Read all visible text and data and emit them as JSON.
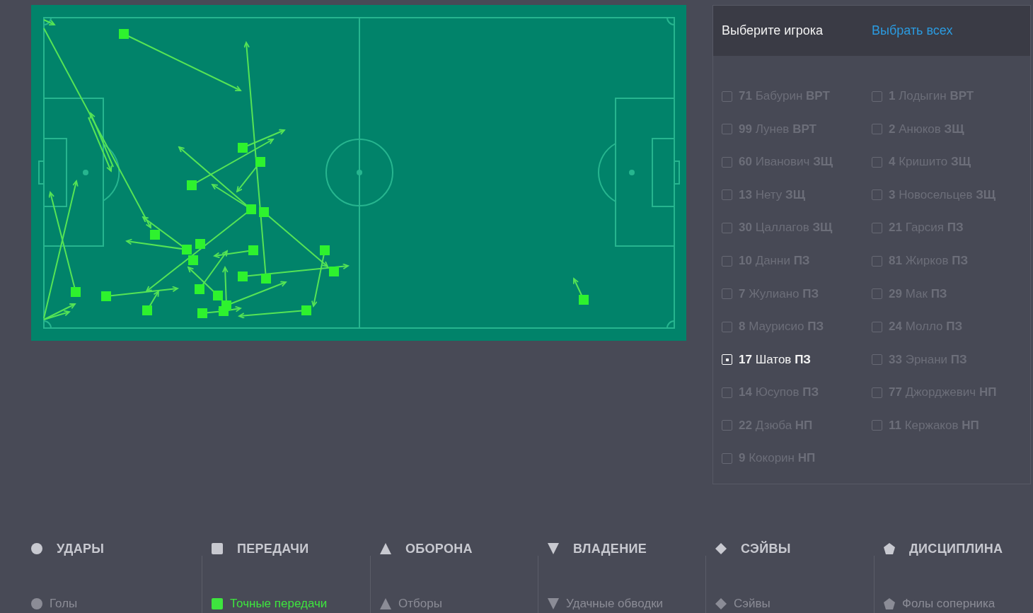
{
  "player_panel": {
    "title": "Выберите игрока",
    "select_all": "Выбрать всех",
    "players": [
      {
        "number": "71",
        "name": "Бабурин",
        "position": "ВРТ",
        "checked": false
      },
      {
        "number": "1",
        "name": "Лодыгин",
        "position": "ВРТ",
        "checked": false
      },
      {
        "number": "99",
        "name": "Лунев",
        "position": "ВРТ",
        "checked": false
      },
      {
        "number": "2",
        "name": "Анюков",
        "position": "ЗЩ",
        "checked": false
      },
      {
        "number": "60",
        "name": "Иванович",
        "position": "ЗЩ",
        "checked": false
      },
      {
        "number": "4",
        "name": "Кришито",
        "position": "ЗЩ",
        "checked": false
      },
      {
        "number": "13",
        "name": "Нету",
        "position": "ЗЩ",
        "checked": false
      },
      {
        "number": "3",
        "name": "Новосельцев",
        "position": "ЗЩ",
        "checked": false
      },
      {
        "number": "30",
        "name": "Цаллагов",
        "position": "ЗЩ",
        "checked": false
      },
      {
        "number": "21",
        "name": "Гарсия",
        "position": "ПЗ",
        "checked": false
      },
      {
        "number": "10",
        "name": "Данни",
        "position": "ПЗ",
        "checked": false
      },
      {
        "number": "81",
        "name": "Жирков",
        "position": "ПЗ",
        "checked": false
      },
      {
        "number": "7",
        "name": "Жулиано",
        "position": "ПЗ",
        "checked": false
      },
      {
        "number": "29",
        "name": "Мак",
        "position": "ПЗ",
        "checked": false
      },
      {
        "number": "8",
        "name": "Маурисио",
        "position": "ПЗ",
        "checked": false
      },
      {
        "number": "24",
        "name": "Молло",
        "position": "ПЗ",
        "checked": false
      },
      {
        "number": "17",
        "name": "Шатов",
        "position": "ПЗ",
        "checked": true
      },
      {
        "number": "33",
        "name": "Эрнани",
        "position": "ПЗ",
        "checked": false
      },
      {
        "number": "14",
        "name": "Юсупов",
        "position": "ПЗ",
        "checked": false
      },
      {
        "number": "77",
        "name": "Джорджевич",
        "position": "НП",
        "checked": false
      },
      {
        "number": "22",
        "name": "Дзюба",
        "position": "НП",
        "checked": false
      },
      {
        "number": "11",
        "name": "Кержаков",
        "position": "НП",
        "checked": false
      },
      {
        "number": "9",
        "name": "Кокорин",
        "position": "НП",
        "checked": false
      }
    ]
  },
  "categories": [
    {
      "kind": "circle",
      "title": "УДАРЫ",
      "items": [
        {
          "label": "Голы",
          "selected": false
        }
      ]
    },
    {
      "kind": "square",
      "title": "ПЕРЕДАЧИ",
      "items": [
        {
          "label": "Точные передачи",
          "selected": true
        }
      ]
    },
    {
      "kind": "triangle",
      "title": "ОБОРОНА",
      "items": [
        {
          "label": "Отборы",
          "selected": false
        }
      ]
    },
    {
      "kind": "triangle-down",
      "title": "ВЛАДЕНИЕ",
      "items": [
        {
          "label": "Удачные обводки",
          "selected": false
        }
      ]
    },
    {
      "kind": "diamond",
      "title": "СЭЙВЫ",
      "items": [
        {
          "label": "Сэйвы",
          "selected": false
        }
      ]
    },
    {
      "kind": "pentagon",
      "title": "ДИСЦИПЛИНА",
      "items": [
        {
          "label": "Фолы соперника",
          "selected": false
        }
      ]
    }
  ]
}
